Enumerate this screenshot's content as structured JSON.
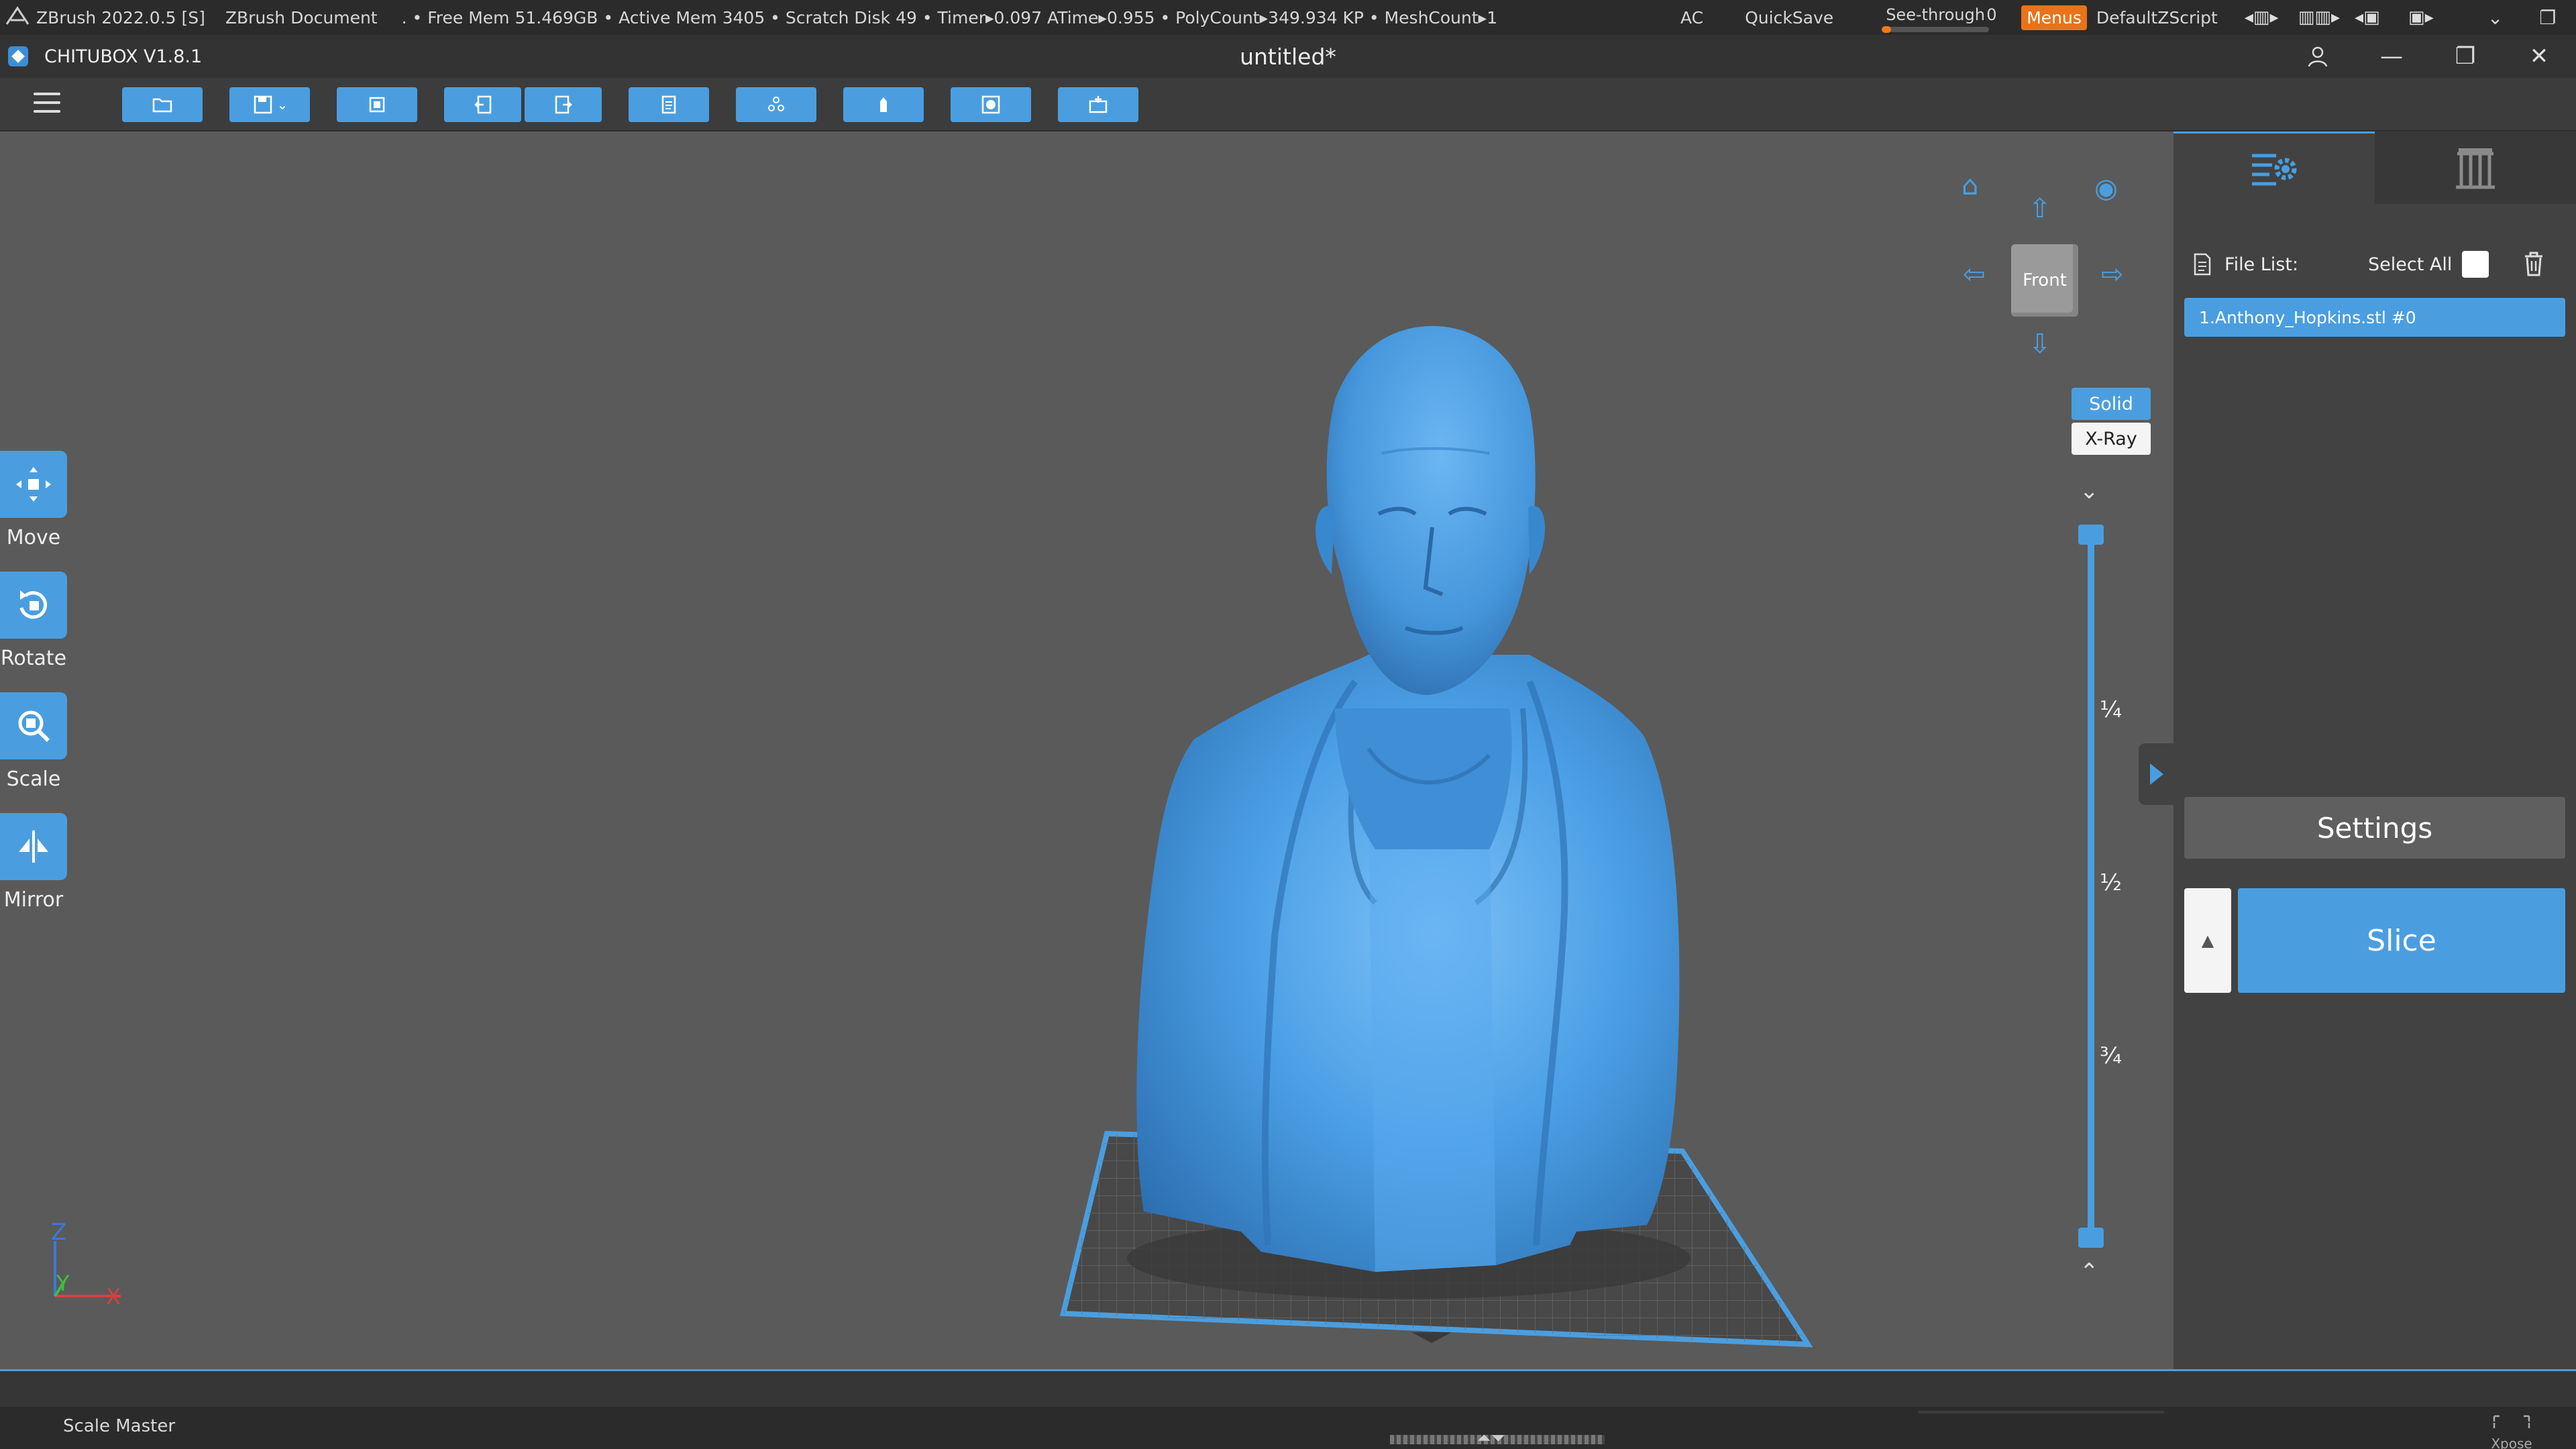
{
  "zbrush_bar": {
    "app": "ZBrush 2022.0.5 [S]",
    "document": "ZBrush Document",
    "stats": ". • Free Mem 51.469GB • Active Mem 3405 • Scratch Disk 49 •  Timer▸0.097 ATime▸0.955 • PolyCount▸349.934 KP  • MeshCount▸1",
    "ac": "AC",
    "quicksave": "QuickSave",
    "see_through_label": "See-through",
    "see_through_value": "0",
    "see_through_level": 0.0,
    "menus": "Menus",
    "script": "DefaultZScript",
    "accent": "#e8731a"
  },
  "app": {
    "name": "CHITUBOX V1.8.1",
    "document_title": "untitled*",
    "accent": "#4a9ee0"
  },
  "toolbar": {
    "buttons": [
      "open-file",
      "save",
      "auto-layout",
      "undo",
      "redo",
      "copy",
      "support",
      "hollow",
      "dig-hole",
      "add-plate"
    ]
  },
  "left_tools": {
    "move": "Move",
    "rotate": "Rotate",
    "scale": "Scale",
    "mirror": "Mirror"
  },
  "viewport": {
    "view_cube_label": "Front",
    "render_mode_solid": "Solid",
    "render_mode_xray": "X-Ray",
    "slider_marks": [
      "¼",
      "½",
      "¾"
    ],
    "axis_z": "Z",
    "axis_y": "Y",
    "axis_x": "X",
    "model_color": "#4b9fe6"
  },
  "right_panel": {
    "file_list_label": "File List:",
    "select_all_label": "Select All",
    "files": [
      "1.Anthony_Hopkins.stl #0"
    ],
    "settings_label": "Settings",
    "slice_label": "Slice"
  },
  "bottom_bar": {
    "scale_master": "Scale Master",
    "xpose": "Xpose"
  }
}
